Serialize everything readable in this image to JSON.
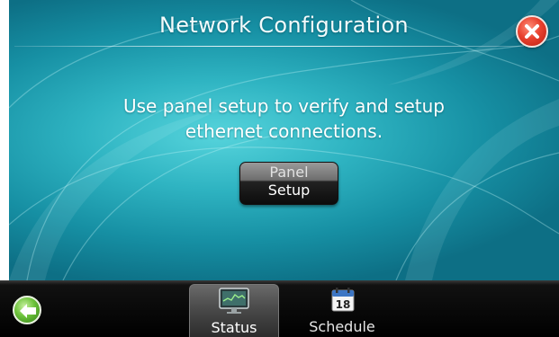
{
  "window": {
    "title": "Network Configuration"
  },
  "content": {
    "message_line1": "Use panel setup to verify and setup",
    "message_line2": "ethernet connections.",
    "panel_button_line1": "Panel",
    "panel_button_line2": "Setup"
  },
  "footer": {
    "tabs": [
      {
        "label": "Status",
        "icon": "status-monitor-icon",
        "active": true
      },
      {
        "label": "Schedule",
        "icon": "calendar-icon",
        "calendar_day": "18",
        "active": false
      }
    ]
  },
  "colors": {
    "background_teal": "#2fb4c2",
    "close_red": "#e8412e",
    "back_green": "#6cc23a",
    "footer_black": "#000000"
  },
  "icons": {
    "close": "close-icon",
    "back": "back-arrow-icon"
  }
}
